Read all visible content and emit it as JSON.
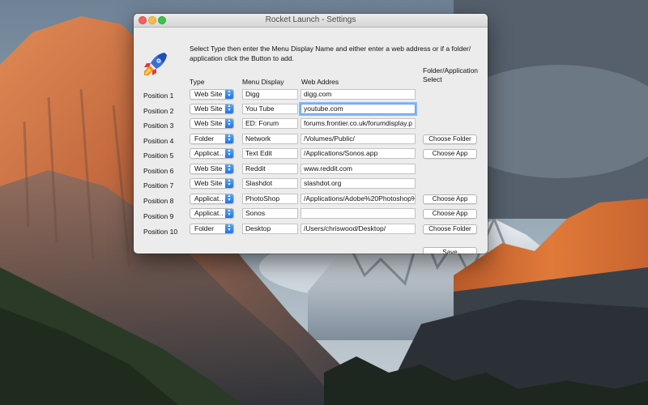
{
  "window": {
    "title": "Rocket Launch - Settings"
  },
  "app_icon": "rocket-icon",
  "instructions": "Select Type then enter the Menu Display Name and either enter a web address or if a folder/ application click the Button to add.",
  "headers": {
    "type": "Type",
    "menu_display": "Menu Display",
    "web_address": "Web Addres",
    "folder_select": "Folder/Application Select"
  },
  "rows": [
    {
      "position": "Position 1",
      "type": "Web Site",
      "name": "Digg",
      "web": "digg.com",
      "button": ""
    },
    {
      "position": "Position 2",
      "type": "Web Site",
      "name": "You Tube",
      "web": "youtube.com",
      "button": ""
    },
    {
      "position": "Position 3",
      "type": "Web Site",
      "name": "ED: Forum",
      "web": "forums.frontier.co.uk/forumdisplay.p",
      "button": ""
    },
    {
      "position": "Position 4",
      "type": "Folder",
      "name": "Network",
      "web": "/Volumes/Public/",
      "button": "Choose Folder"
    },
    {
      "position": "Position 5",
      "type": "Applicat…",
      "name": "Text Edit",
      "web": "/Applications/Sonos.app",
      "button": "Choose App"
    },
    {
      "position": "Position 6",
      "type": "Web Site",
      "name": "Reddit",
      "web": "www.reddit.com",
      "button": ""
    },
    {
      "position": "Position 7",
      "type": "Web Site",
      "name": "Slashdot",
      "web": "slashdot.org",
      "button": ""
    },
    {
      "position": "Position 8",
      "type": "Applicat…",
      "name": "PhotoShop",
      "web": "/Applications/Adobe%20Photoshop%",
      "button": "Choose App"
    },
    {
      "position": "Position 9",
      "type": "Applicat…",
      "name": "Sonos",
      "web": "",
      "button": "Choose App"
    },
    {
      "position": "Position 10",
      "type": "Folder",
      "name": "Desktop",
      "web": "/Users/chriswood/Desktop/",
      "button": "Choose Folder"
    }
  ],
  "save_label": "Save",
  "colors": {
    "accent": "#1f6fe0",
    "focus_ring": "#8db8f5",
    "window_bg": "#ececec"
  }
}
